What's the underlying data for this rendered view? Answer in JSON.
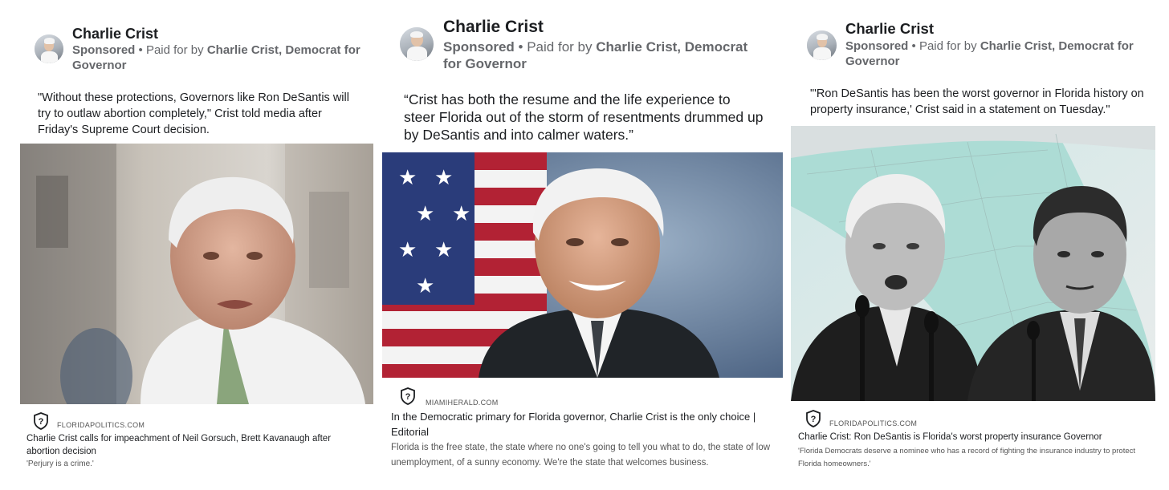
{
  "ads": [
    {
      "sponsor_name": "Charlie Crist",
      "sponsored_label": "Sponsored",
      "paid_for_by_label": "Paid for by",
      "paid_for_by_value": "Charlie Crist, Democrat for Governor",
      "caption": "\"Without these protections, Governors like Ron DeSantis will try to outlaw abortion completely,\" Crist told media after Friday's Supreme Court decision.",
      "link": {
        "domain": "FLORIDAPOLITICS.COM",
        "headline": "Charlie Crist calls for impeachment of Neil Gorsuch, Brett Kavanaugh after abortion decision",
        "description": "'Perjury is a crime.'"
      },
      "icon": "shield-question-icon"
    },
    {
      "sponsor_name": "Charlie Crist",
      "sponsored_label": "Sponsored",
      "paid_for_by_label": "Paid for by",
      "paid_for_by_value": "Charlie Crist, Democrat for Governor",
      "caption": "“Crist has both the resume and the life experience to steer Florida out of the storm of resentments drummed up by DeSantis and into calmer waters.”",
      "link": {
        "domain": "MIAMIHERALD.COM",
        "headline": "In the Democratic primary for Florida governor, Charlie Crist is the only choice | Editorial",
        "description": "Florida is the free state, the state where no one's going to tell you what to do, the state of low unemployment, of a sunny economy. We're the state that welcomes business."
      },
      "icon": "shield-question-icon"
    },
    {
      "sponsor_name": "Charlie Crist",
      "sponsored_label": "Sponsored",
      "paid_for_by_label": "Paid for by",
      "paid_for_by_value": "Charlie Crist, Democrat for Governor",
      "caption": "\"'Ron DeSantis has been the worst governor in Florida history on property insurance,' Crist said in a statement on Tuesday.\"",
      "link": {
        "domain": "FLORIDAPOLITICS.COM",
        "headline": "Charlie Crist: Ron DeSantis is Florida's worst property insurance Governor",
        "description": "'Florida Democrats deserve a nominee who has a record of fighting the insurance industry to protect Florida homeowners.'"
      },
      "icon": "shield-question-icon"
    }
  ],
  "colors": {
    "text_primary": "#1c1e21",
    "text_secondary": "#65676b",
    "link_description": "#555555"
  }
}
